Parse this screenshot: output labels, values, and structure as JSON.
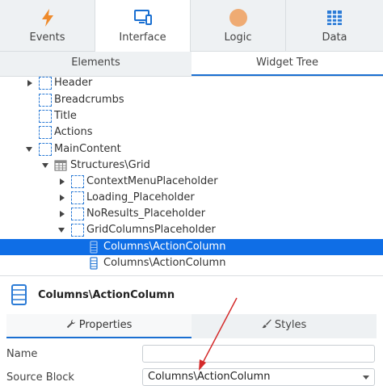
{
  "top_tabs": [
    {
      "label": "Events",
      "icon": "lightning-icon",
      "color": "#ee8a2b"
    },
    {
      "label": "Interface",
      "icon": "monitor-icon",
      "color": "#1a6fd1",
      "active": true
    },
    {
      "label": "Logic",
      "icon": "circle-icon",
      "color": "#efab73"
    },
    {
      "label": "Data",
      "icon": "table-icon",
      "color": "#2b7bd6"
    }
  ],
  "sub_tabs": [
    {
      "label": "Elements"
    },
    {
      "label": "Widget Tree",
      "active": true
    }
  ],
  "tree": [
    {
      "label": "Header",
      "indent": 0,
      "caret": "right",
      "icon": "placeholder-icon"
    },
    {
      "label": "Breadcrumbs",
      "indent": 0,
      "caret": "none",
      "icon": "placeholder-icon"
    },
    {
      "label": "Title",
      "indent": 0,
      "caret": "none",
      "icon": "placeholder-icon"
    },
    {
      "label": "Actions",
      "indent": 0,
      "caret": "none",
      "icon": "placeholder-icon"
    },
    {
      "label": "MainContent",
      "indent": 0,
      "caret": "down",
      "icon": "placeholder-icon"
    },
    {
      "label": "Structures\\Grid",
      "indent": 1,
      "caret": "down",
      "icon": "grid-icon"
    },
    {
      "label": "ContextMenuPlaceholder",
      "indent": 2,
      "caret": "right",
      "icon": "placeholder-icon"
    },
    {
      "label": "Loading_Placeholder",
      "indent": 2,
      "caret": "right",
      "icon": "placeholder-icon"
    },
    {
      "label": "NoResults_Placeholder",
      "indent": 2,
      "caret": "right",
      "icon": "placeholder-icon"
    },
    {
      "label": "GridColumnsPlaceholder",
      "indent": 2,
      "caret": "down",
      "icon": "placeholder-icon"
    },
    {
      "label": "Columns\\ActionColumn",
      "indent": 3,
      "caret": "none",
      "icon": "block-icon",
      "selected": true
    },
    {
      "label": "Columns\\ActionColumn",
      "indent": 3,
      "caret": "none",
      "icon": "block-icon"
    }
  ],
  "properties": {
    "title": "Columns\\ActionColumn",
    "icon": "block-icon",
    "tabs": [
      {
        "label": "Properties",
        "icon": "wrench-icon",
        "active": true
      },
      {
        "label": "Styles",
        "icon": "brush-icon"
      }
    ],
    "fields": [
      {
        "label": "Name",
        "value": "",
        "type": "text"
      },
      {
        "label": "Source Block",
        "value": "Columns\\ActionColumn",
        "type": "select"
      }
    ]
  },
  "colors": {
    "accent": "#1a6fd1",
    "selection": "#0f6ee6",
    "annotation_arrow": "#d42a2a"
  }
}
